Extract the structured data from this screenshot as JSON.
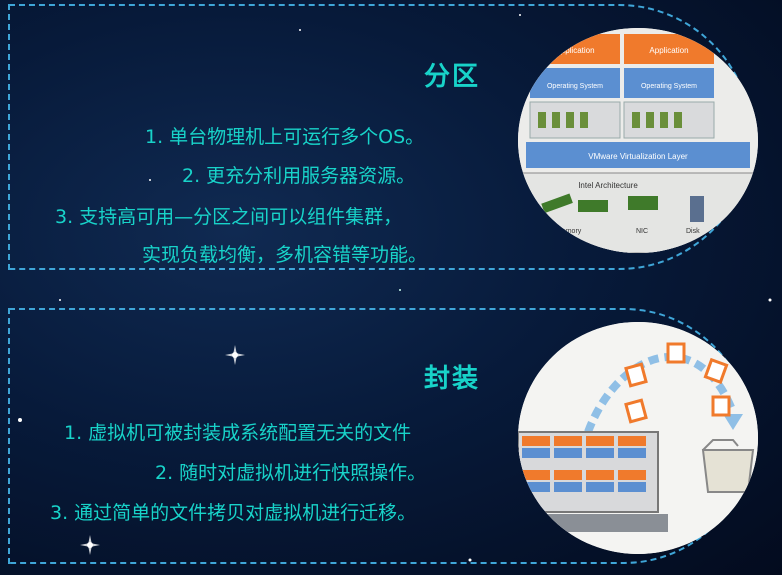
{
  "section1": {
    "title": "分区",
    "lines": [
      "1.  单台物理机上可运行多个OS。",
      "2.      更充分利用服务器资源。",
      "3.      支持高可用—分区之间可以组件集群，",
      "实现负载均衡，多机容错等功能。"
    ],
    "diagram": {
      "app_label": "Application",
      "os_label": "Operating System",
      "vmware_label": "VMware Virtualization Layer",
      "intel_label": "Intel Architecture",
      "memory_label": "Memory",
      "nic_label": "NIC",
      "disk_label": "Disk"
    }
  },
  "section2": {
    "title": "封装",
    "lines": [
      "1.  虚拟机可被封装成系统配置无关的文件",
      "2.  随时对虚拟机进行快照操作。",
      "3.  通过简单的文件拷贝对虚拟机进行迁移。"
    ]
  },
  "colors": {
    "accent": "#18d3c9",
    "border": "#3fa6d8",
    "orange": "#f07a2c",
    "blue": "#5b8fd1"
  }
}
